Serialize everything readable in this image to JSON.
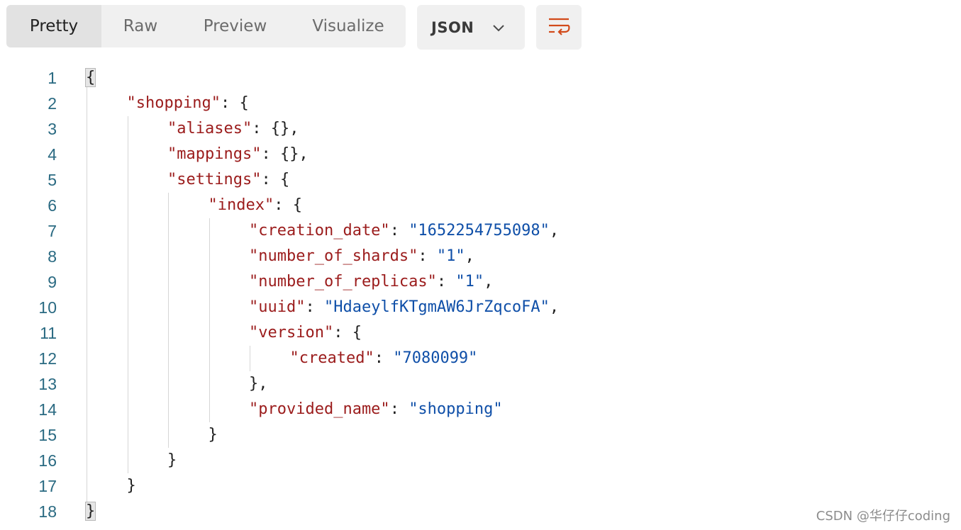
{
  "tabs": [
    "Pretty",
    "Raw",
    "Preview",
    "Visualize"
  ],
  "active_tab": "Pretty",
  "format": {
    "label": "JSON"
  },
  "watermark": "CSDN @华仔仔coding",
  "code_lines": [
    {
      "n": "1",
      "indent": 0,
      "tokens": [
        {
          "t": "p",
          "v": "{"
        }
      ]
    },
    {
      "n": "2",
      "indent": 1,
      "tokens": [
        {
          "t": "k",
          "v": "\"shopping\""
        },
        {
          "t": "p",
          "v": ": {"
        }
      ]
    },
    {
      "n": "3",
      "indent": 2,
      "tokens": [
        {
          "t": "k",
          "v": "\"aliases\""
        },
        {
          "t": "p",
          "v": ": {},"
        }
      ]
    },
    {
      "n": "4",
      "indent": 2,
      "tokens": [
        {
          "t": "k",
          "v": "\"mappings\""
        },
        {
          "t": "p",
          "v": ": {},"
        }
      ]
    },
    {
      "n": "5",
      "indent": 2,
      "tokens": [
        {
          "t": "k",
          "v": "\"settings\""
        },
        {
          "t": "p",
          "v": ": {"
        }
      ]
    },
    {
      "n": "6",
      "indent": 3,
      "tokens": [
        {
          "t": "k",
          "v": "\"index\""
        },
        {
          "t": "p",
          "v": ": {"
        }
      ]
    },
    {
      "n": "7",
      "indent": 4,
      "tokens": [
        {
          "t": "k",
          "v": "\"creation_date\""
        },
        {
          "t": "p",
          "v": ": "
        },
        {
          "t": "s",
          "v": "\"1652254755098\""
        },
        {
          "t": "p",
          "v": ","
        }
      ]
    },
    {
      "n": "8",
      "indent": 4,
      "tokens": [
        {
          "t": "k",
          "v": "\"number_of_shards\""
        },
        {
          "t": "p",
          "v": ": "
        },
        {
          "t": "s",
          "v": "\"1\""
        },
        {
          "t": "p",
          "v": ","
        }
      ]
    },
    {
      "n": "9",
      "indent": 4,
      "tokens": [
        {
          "t": "k",
          "v": "\"number_of_replicas\""
        },
        {
          "t": "p",
          "v": ": "
        },
        {
          "t": "s",
          "v": "\"1\""
        },
        {
          "t": "p",
          "v": ","
        }
      ]
    },
    {
      "n": "10",
      "indent": 4,
      "tokens": [
        {
          "t": "k",
          "v": "\"uuid\""
        },
        {
          "t": "p",
          "v": ": "
        },
        {
          "t": "s",
          "v": "\"HdaeylfKTgmAW6JrZqcoFA\""
        },
        {
          "t": "p",
          "v": ","
        }
      ]
    },
    {
      "n": "11",
      "indent": 4,
      "tokens": [
        {
          "t": "k",
          "v": "\"version\""
        },
        {
          "t": "p",
          "v": ": {"
        }
      ]
    },
    {
      "n": "12",
      "indent": 5,
      "tokens": [
        {
          "t": "k",
          "v": "\"created\""
        },
        {
          "t": "p",
          "v": ": "
        },
        {
          "t": "s",
          "v": "\"7080099\""
        }
      ]
    },
    {
      "n": "13",
      "indent": 4,
      "tokens": [
        {
          "t": "p",
          "v": "},"
        }
      ]
    },
    {
      "n": "14",
      "indent": 4,
      "tokens": [
        {
          "t": "k",
          "v": "\"provided_name\""
        },
        {
          "t": "p",
          "v": ": "
        },
        {
          "t": "s",
          "v": "\"shopping\""
        }
      ]
    },
    {
      "n": "15",
      "indent": 3,
      "tokens": [
        {
          "t": "p",
          "v": "}"
        }
      ]
    },
    {
      "n": "16",
      "indent": 2,
      "tokens": [
        {
          "t": "p",
          "v": "}"
        }
      ]
    },
    {
      "n": "17",
      "indent": 1,
      "tokens": [
        {
          "t": "p",
          "v": "}"
        }
      ]
    },
    {
      "n": "18",
      "indent": 0,
      "tokens": [
        {
          "t": "p",
          "v": "}"
        }
      ]
    }
  ]
}
